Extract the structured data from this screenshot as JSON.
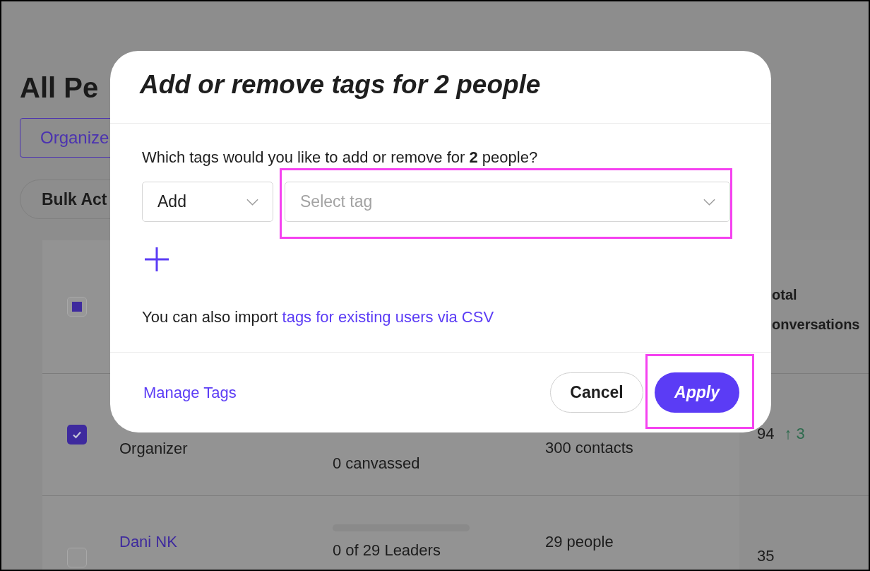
{
  "page": {
    "title": "All Pe",
    "view_tab": {
      "label": "Organize",
      "selected": true
    },
    "bulk_actions": "Bulk Act"
  },
  "table": {
    "header": {
      "indeterminate": true,
      "column_5": [
        "otal",
        "onversations"
      ]
    },
    "rows": [
      {
        "checked": true,
        "role": "Organizer",
        "canvassed": "0 canvassed",
        "contacts": "300 contacts",
        "total": "94",
        "change": "↑ 3"
      },
      {
        "checked": false,
        "name": "Dani NK",
        "level": 0,
        "leaders": "0 of 29 Leaders",
        "people": "29 people",
        "total": "35"
      }
    ]
  },
  "dialog": {
    "title": "Add or remove tags for 2 people",
    "prompt": "Which tags would you like to add or remove for **2** people?",
    "action_select": {
      "value": "Add"
    },
    "tag_select": {
      "placeholder": "Select tag",
      "highlighted": true
    },
    "import_text": "You can also import",
    "import_link": "tags for existing users via CSV",
    "manage_link": "Manage Tags",
    "cancel": {
      "label": "Cancel"
    },
    "apply": {
      "label": "Apply",
      "highlighted": true
    }
  }
}
